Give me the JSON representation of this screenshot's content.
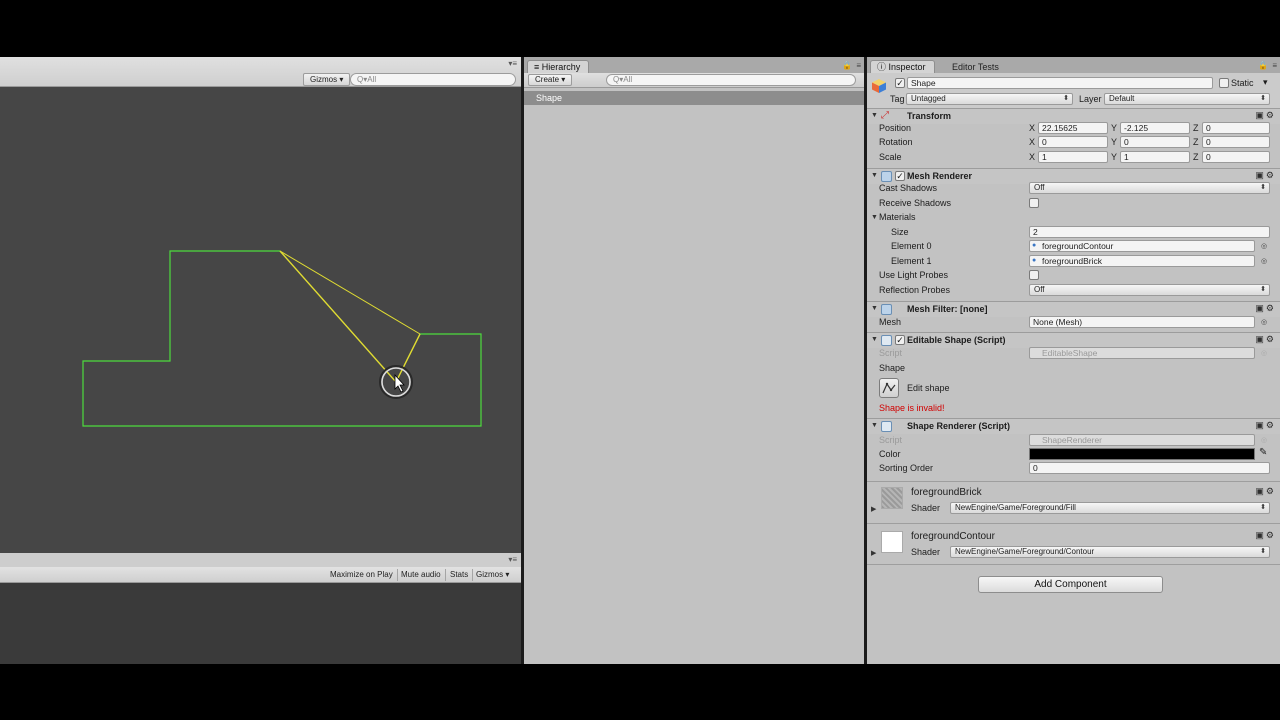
{
  "scene": {
    "gizmos_label": "Gizmos",
    "search_placeholder": "Q▾All"
  },
  "game": {
    "buttons": [
      "Maximize on Play",
      "Mute audio",
      "Stats",
      "Gizmos"
    ]
  },
  "hierarchy": {
    "tab_label": "Hierarchy",
    "create_label": "Create",
    "search_placeholder": "Q▾All",
    "items": [
      "Shape"
    ]
  },
  "inspector": {
    "tab_label": "Inspector",
    "tab2_label": "Editor Tests",
    "object_name": "Shape",
    "static_label": "Static",
    "tag_label": "Tag",
    "tag_value": "Untagged",
    "layer_label": "Layer",
    "layer_value": "Default",
    "transform": {
      "title": "Transform",
      "position_label": "Position",
      "rotation_label": "Rotation",
      "scale_label": "Scale",
      "position": {
        "x": "22.15625",
        "y": "-2.125",
        "z": "0"
      },
      "rotation": {
        "x": "0",
        "y": "0",
        "z": "0"
      },
      "scale": {
        "x": "1",
        "y": "1",
        "z": "0"
      },
      "axes": {
        "x": "X",
        "y": "Y",
        "z": "Z"
      }
    },
    "mesh_renderer": {
      "title": "Mesh Renderer",
      "cast_shadows_label": "Cast Shadows",
      "cast_shadows_value": "Off",
      "receive_shadows_label": "Receive Shadows",
      "materials_label": "Materials",
      "size_label": "Size",
      "size_value": "2",
      "element0_label": "Element 0",
      "element0_value": "foregroundContour",
      "element1_label": "Element 1",
      "element1_value": "foregroundBrick",
      "light_probes_label": "Use Light Probes",
      "reflection_probes_label": "Reflection Probes",
      "reflection_probes_value": "Off"
    },
    "mesh_filter": {
      "title": "Mesh Filter: [none]",
      "mesh_label": "Mesh",
      "mesh_value": "None (Mesh)"
    },
    "editable_shape": {
      "title": "Editable Shape (Script)",
      "script_label": "Script",
      "script_value": "EditableShape",
      "shape_label": "Shape",
      "edit_label": "Edit shape",
      "error": "Shape is invalid!"
    },
    "shape_renderer": {
      "title": "Shape Renderer (Script)",
      "script_label": "Script",
      "script_value": "ShapeRenderer",
      "color_label": "Color",
      "color_value": "#000000",
      "sorting_label": "Sorting Order",
      "sorting_value": "0"
    },
    "materials": [
      {
        "name": "foregroundBrick",
        "shader_label": "Shader",
        "shader": "NewEngine/Game/Foreground/Fill"
      },
      {
        "name": "foregroundContour",
        "shader_label": "Shader",
        "shader": "NewEngine/Game/Foreground/Contour"
      }
    ],
    "add_component": "Add Component"
  },
  "colors": {
    "outline": "#4cdc3c",
    "edit_line": "#e0dc32",
    "scene_bg": "#464646"
  }
}
